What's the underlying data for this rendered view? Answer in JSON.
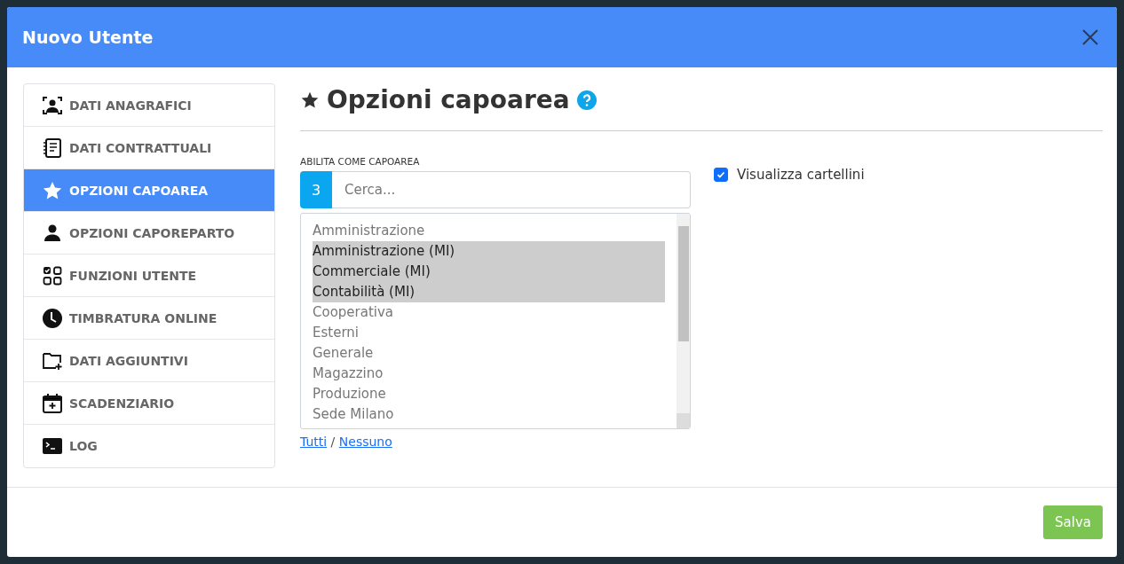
{
  "dialog": {
    "title": "Nuovo Utente"
  },
  "sidebar": {
    "items": [
      {
        "label": "DATI ANAGRAFICI",
        "selected": false
      },
      {
        "label": "DATI CONTRATTUALI",
        "selected": false
      },
      {
        "label": "OPZIONI CAPOAREA",
        "selected": true
      },
      {
        "label": "OPZIONI CAPOREPARTO",
        "selected": false
      },
      {
        "label": "FUNZIONI UTENTE",
        "selected": false
      },
      {
        "label": "TIMBRATURA ONLINE",
        "selected": false
      },
      {
        "label": "DATI AGGIUNTIVI",
        "selected": false
      },
      {
        "label": "SCADENZIARIO",
        "selected": false
      },
      {
        "label": "LOG",
        "selected": false
      }
    ]
  },
  "section": {
    "title": "Opzioni capoarea",
    "field_label": "ABILITA COME CAPOAREA",
    "count_badge": "3",
    "search": {
      "placeholder": "Cerca..."
    },
    "options": [
      {
        "label": "Amministrazione",
        "selected": false
      },
      {
        "label": "Amministrazione (MI)",
        "selected": true
      },
      {
        "label": "Commerciale (MI)",
        "selected": true
      },
      {
        "label": "Contabilità (MI)",
        "selected": true
      },
      {
        "label": "Cooperativa",
        "selected": false
      },
      {
        "label": "Esterni",
        "selected": false
      },
      {
        "label": "Generale",
        "selected": false
      },
      {
        "label": "Magazzino",
        "selected": false
      },
      {
        "label": "Produzione",
        "selected": false
      },
      {
        "label": "Sede Milano",
        "selected": false
      }
    ],
    "links": [
      "Tutti",
      "Nessuno"
    ],
    "link_separator": "/",
    "checkbox": {
      "label": "Visualizza cartellini",
      "checked": true
    }
  },
  "buttons": [
    "Salva"
  ]
}
